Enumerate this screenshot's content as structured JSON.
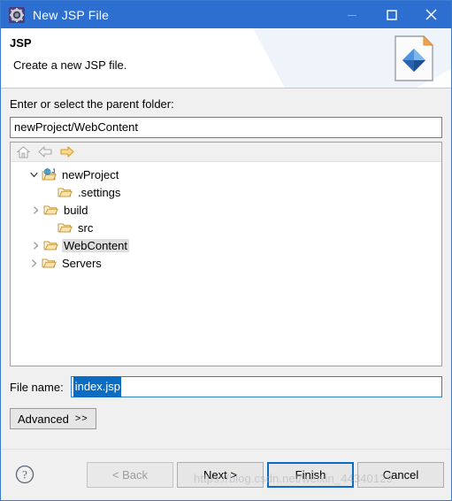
{
  "window": {
    "title": "New JSP File",
    "icon": "gear-icon",
    "controls": {
      "minimize": "minimize-icon",
      "maximize": "maximize-icon",
      "close": "close-icon"
    },
    "accent_color": "#2d6fd0"
  },
  "banner": {
    "title": "JSP",
    "subtitle": "Create a new JSP file.",
    "icon": "jsp-file-icon"
  },
  "form": {
    "parent_folder_label": "Enter or select the parent folder:",
    "parent_folder_value": "newProject/WebContent",
    "parent_folder_placeholder": "",
    "file_name_label": "File name:",
    "file_name_value": "index.jsp",
    "file_name_placeholder": "",
    "advanced_label": "Advanced",
    "advanced_chevrons": ">>"
  },
  "tree_toolbar": {
    "home": "home-icon",
    "back": "back-arrow-icon",
    "forward": "forward-arrow-icon"
  },
  "tree": {
    "items": [
      {
        "label": "newProject",
        "indent": 0,
        "twisty": "expanded",
        "icon": "java-web-project-icon",
        "selected": false
      },
      {
        "label": ".settings",
        "indent": 1,
        "twisty": "none",
        "icon": "folder-icon",
        "selected": false
      },
      {
        "label": "build",
        "indent": 1,
        "twisty": "collapsed",
        "icon": "folder-icon",
        "selected": false
      },
      {
        "label": "src",
        "indent": 1,
        "twisty": "none",
        "icon": "folder-icon",
        "selected": false
      },
      {
        "label": "WebContent",
        "indent": 1,
        "twisty": "collapsed",
        "icon": "folder-icon",
        "selected": true
      },
      {
        "label": "Servers",
        "indent": 0,
        "twisty": "collapsed",
        "icon": "folder-icon",
        "selected": false
      }
    ]
  },
  "footer": {
    "help": "help-icon",
    "buttons": [
      {
        "label": "< Back",
        "state": "disabled"
      },
      {
        "label": "Next >",
        "state": "enabled"
      },
      {
        "label": "Finish",
        "state": "default"
      },
      {
        "label": "Cancel",
        "state": "enabled"
      }
    ]
  },
  "watermark": {
    "text": "https://blog.csdn.net/weixin_44340129"
  }
}
